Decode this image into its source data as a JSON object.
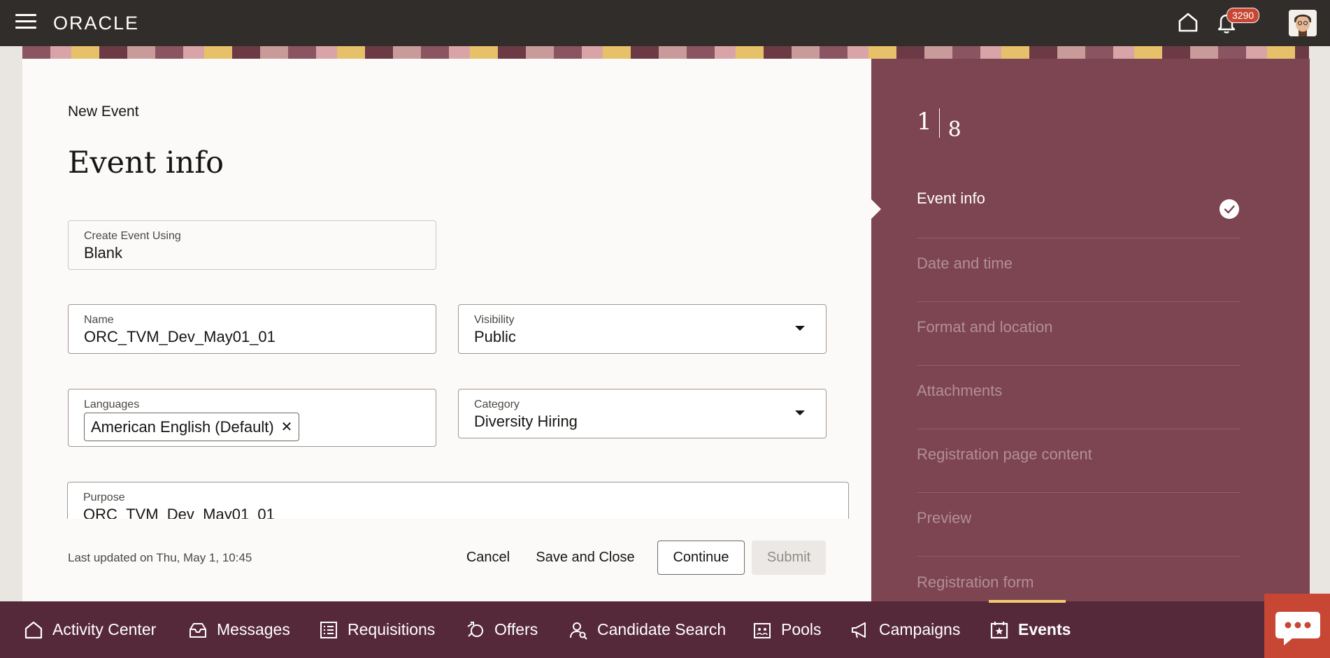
{
  "topbar": {
    "logo": "ORACLE",
    "notification_count": "3290"
  },
  "form": {
    "breadcrumb": "New Event",
    "title": "Event info",
    "create_using": {
      "label": "Create Event Using",
      "value": "Blank"
    },
    "name": {
      "label": "Name",
      "value": "ORC_TVM_Dev_May01_01"
    },
    "visibility": {
      "label": "Visibility",
      "value": "Public"
    },
    "languages": {
      "label": "Languages",
      "chip": "American English (Default)"
    },
    "category": {
      "label": "Category",
      "value": "Diversity Hiring"
    },
    "purpose": {
      "label": "Purpose",
      "value": "ORC_TVM_Dev_May01_01"
    }
  },
  "footer": {
    "last_updated": "Last updated on Thu, May 1, 10:45",
    "cancel": "Cancel",
    "save_close": "Save and Close",
    "continue": "Continue",
    "submit": "Submit"
  },
  "steps": {
    "current": "1",
    "total": "8",
    "items": [
      {
        "label": "Event info"
      },
      {
        "label": "Date and time"
      },
      {
        "label": "Format and location"
      },
      {
        "label": "Attachments"
      },
      {
        "label": "Registration page content"
      },
      {
        "label": "Preview"
      },
      {
        "label": "Registration form"
      }
    ]
  },
  "bottom_nav": {
    "items": [
      {
        "label": "Activity Center",
        "icon": "home-icon"
      },
      {
        "label": "Messages",
        "icon": "inbox-icon"
      },
      {
        "label": "Requisitions",
        "icon": "list-icon"
      },
      {
        "label": "Offers",
        "icon": "offer-icon"
      },
      {
        "label": "Candidate Search",
        "icon": "person-search-icon"
      },
      {
        "label": "Pools",
        "icon": "building-icon"
      },
      {
        "label": "Campaigns",
        "icon": "megaphone-icon"
      },
      {
        "label": "Events",
        "icon": "calendar-star-icon"
      }
    ],
    "active": "Events"
  },
  "colors": {
    "topbar": "#312d2a",
    "steps_panel": "#7d4451",
    "bottom_nav": "#56293a",
    "accent_badge": "#c74634",
    "active_underline": "#f0cc71"
  }
}
